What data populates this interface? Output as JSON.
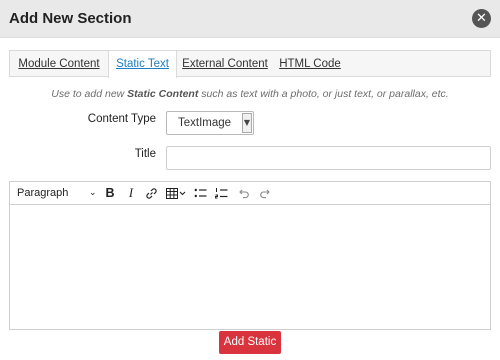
{
  "dialog": {
    "title": "Add New Section",
    "close_glyph": "✕"
  },
  "tabs": [
    {
      "label": "Module Content",
      "active": false
    },
    {
      "label": "Static Text",
      "active": true
    },
    {
      "label": "External Content",
      "active": false
    },
    {
      "label": "HTML Code",
      "active": false
    }
  ],
  "hint": {
    "before": "Use to add new ",
    "emphasis": "Static Content",
    "after": " such as text with a photo, or just text, or parallax, etc."
  },
  "form": {
    "content_type_label": "Content Type",
    "content_type_value": "TextImage",
    "title_label": "Title",
    "title_value": ""
  },
  "editor": {
    "format_value": "Paragraph",
    "bold_glyph": "B",
    "italic_glyph": "I",
    "icons": [
      "chevron-down-icon",
      "bold-icon",
      "italic-icon",
      "link-icon",
      "table-icon",
      "bullet-list-icon",
      "numbered-list-icon",
      "undo-icon",
      "redo-icon"
    ],
    "content": ""
  },
  "actions": {
    "submit_label": "Add Static"
  },
  "colors": {
    "header_bg": "#e9e9e9",
    "active_tab_text": "#1f7dc2",
    "submit_bg": "#d9343d"
  }
}
